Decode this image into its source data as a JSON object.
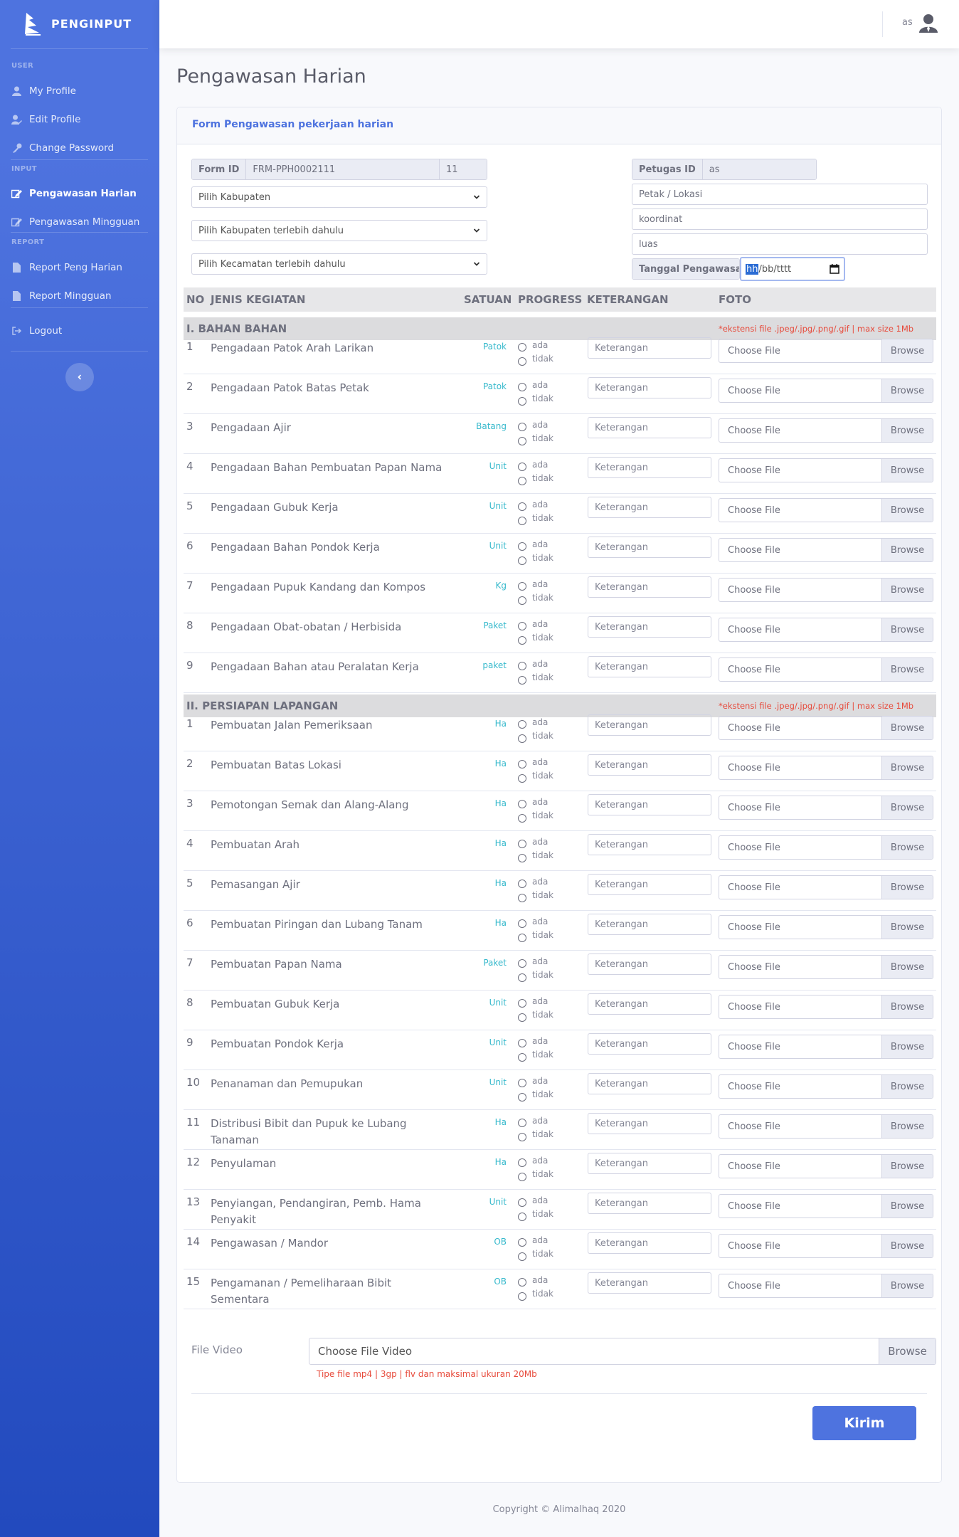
{
  "app": {
    "brand": "PENGINPUT"
  },
  "sidebar": {
    "headings": {
      "user": "USER",
      "input": "INPUT",
      "report": "REPORT"
    },
    "items": [
      {
        "label": "My Profile",
        "icon": "user-icon"
      },
      {
        "label": "Edit Profile",
        "icon": "user-edit-icon"
      },
      {
        "label": "Change Password",
        "icon": "key-icon"
      },
      {
        "label": "Pengawasan Harian",
        "icon": "edit-icon",
        "active": true
      },
      {
        "label": "Pengawasan Mingguan",
        "icon": "edit-icon"
      },
      {
        "label": "Report Peng Harian",
        "icon": "file-icon"
      },
      {
        "label": "Report Mingguan",
        "icon": "file-icon"
      },
      {
        "label": "Logout",
        "icon": "logout-icon"
      }
    ]
  },
  "topbar": {
    "username": "as"
  },
  "page": {
    "title": "Pengawasan Harian",
    "card_title": "Form Pengawasan pekerjaan harian"
  },
  "form": {
    "form_id_label": "Form ID",
    "form_id_value": "FRM-PPH0002111",
    "form_id_suffix": "11",
    "select_kabupaten": "Pilih Kabupaten",
    "select_kab_first": "Pilih Kabupaten terlebih dahulu",
    "select_kec_first": "Pilih Kecamatan terlebih dahulu",
    "petugas_label": "Petugas ID",
    "petugas_value": "as",
    "petak_placeholder": "Petak / Lokasi",
    "koordinat_placeholder": "koordinat",
    "luas_placeholder": "luas",
    "tanggal_label": "Tanggal Pengawasan",
    "date_hh": "hh",
    "date_rest": "/bb/tttt"
  },
  "table": {
    "headers": [
      "NO",
      "JENIS KEGIATAN",
      "SATUAN",
      "PROGRESS",
      "KETERANGAN",
      "FOTO"
    ],
    "radio_yes": "ada",
    "radio_no": "tidak",
    "ket_placeholder": "Keterangan",
    "file_placeholder": "Choose File",
    "browse": "Browse",
    "note": "*ekstensi file .jpeg/.jpg/.png/.gif | max size 1Mb",
    "sections": [
      {
        "title": "I. BAHAN BAHAN",
        "rows": [
          {
            "no": "1",
            "name": "Pengadaan Patok Arah Larikan",
            "unit": "Patok"
          },
          {
            "no": "2",
            "name": "Pengadaan Patok Batas Petak",
            "unit": "Patok"
          },
          {
            "no": "3",
            "name": "Pengadaan Ajir",
            "unit": "Batang"
          },
          {
            "no": "4",
            "name": "Pengadaan Bahan Pembuatan Papan Nama",
            "unit": "Unit"
          },
          {
            "no": "5",
            "name": "Pengadaan Gubuk Kerja",
            "unit": "Unit"
          },
          {
            "no": "6",
            "name": "Pengadaan Bahan Pondok Kerja",
            "unit": "Unit"
          },
          {
            "no": "7",
            "name": "Pengadaan Pupuk Kandang dan Kompos",
            "unit": "Kg"
          },
          {
            "no": "8",
            "name": "Pengadaan Obat-obatan / Herbisida",
            "unit": "Paket"
          },
          {
            "no": "9",
            "name": "Pengadaan Bahan atau Peralatan Kerja",
            "unit": "paket"
          }
        ]
      },
      {
        "title": "II. PERSIAPAN LAPANGAN",
        "rows": [
          {
            "no": "1",
            "name": "Pembuatan Jalan Pemeriksaan",
            "unit": "Ha"
          },
          {
            "no": "2",
            "name": "Pembuatan Batas Lokasi",
            "unit": "Ha"
          },
          {
            "no": "3",
            "name": "Pemotongan Semak dan Alang-Alang",
            "unit": "Ha"
          },
          {
            "no": "4",
            "name": "Pembuatan Arah",
            "unit": "Ha"
          },
          {
            "no": "5",
            "name": "Pemasangan Ajir",
            "unit": "Ha"
          },
          {
            "no": "6",
            "name": "Pembuatan Piringan dan Lubang Tanam",
            "unit": "Ha"
          },
          {
            "no": "7",
            "name": "Pembuatan Papan Nama",
            "unit": "Paket"
          },
          {
            "no": "8",
            "name": "Pembuatan Gubuk Kerja",
            "unit": "Unit"
          },
          {
            "no": "9",
            "name": "Pembuatan Pondok Kerja",
            "unit": "Unit"
          },
          {
            "no": "10",
            "name": "Penanaman dan Pemupukan",
            "unit": "Unit"
          },
          {
            "no": "11",
            "name": "Distribusi Bibit dan Pupuk ke Lubang Tanaman",
            "unit": "Ha"
          },
          {
            "no": "12",
            "name": "Penyulaman",
            "unit": "Ha"
          },
          {
            "no": "13",
            "name": "Penyiangan, Pendangiran, Pemb. Hama Penyakit",
            "unit": "Unit"
          },
          {
            "no": "14",
            "name": "Pengawasan / Mandor",
            "unit": "OB"
          },
          {
            "no": "15",
            "name": "Pengamanan / Pemeliharaan Bibit Sementara",
            "unit": "OB"
          }
        ]
      }
    ]
  },
  "video": {
    "label": "File Video",
    "placeholder": "Choose File Video",
    "browse": "Browse",
    "note": "Tipe file mp4 | 3gp | flv dan maksimal ukuran 20Mb"
  },
  "submit_label": "Kirim",
  "footer": "Copyright © Alimalhaq 2020",
  "colors": {
    "primary": "#4e73df",
    "sidebar_dark": "#224abe",
    "danger": "#e74a3b",
    "info": "#36b9cc"
  }
}
